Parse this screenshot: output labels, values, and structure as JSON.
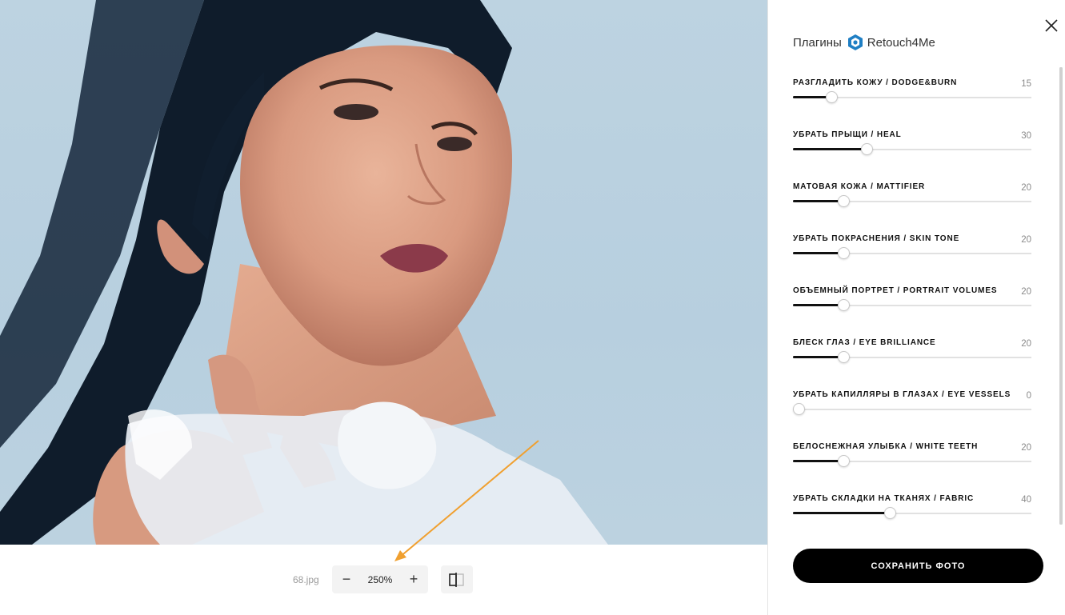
{
  "viewer": {
    "filename": "68.jpg",
    "zoom": "250%",
    "zoom_out_label": "−",
    "zoom_in_label": "+"
  },
  "panel": {
    "title": "Плагины",
    "brand": "Retouch4Me",
    "save_label": "СОХРАНИТЬ ФОТО"
  },
  "plugins": [
    {
      "label": "РАЗГЛАДИТЬ КОЖУ / DODGE&BURN",
      "value": "15",
      "fraction": 0.16
    },
    {
      "label": "УБРАТЬ ПРЫЩИ / HEAL",
      "value": "30",
      "fraction": 0.31
    },
    {
      "label": "МАТОВАЯ КОЖА / MATTIFIER",
      "value": "20",
      "fraction": 0.21
    },
    {
      "label": "УБРАТЬ ПОКРАСНЕНИЯ / SKIN TONE",
      "value": "20",
      "fraction": 0.21
    },
    {
      "label": "ОБЪЕМНЫЙ ПОРТРЕТ / PORTRAIT VOLUMES",
      "value": "20",
      "fraction": 0.21
    },
    {
      "label": "БЛЕСК ГЛАЗ / EYE BRILLIANCE",
      "value": "20",
      "fraction": 0.21
    },
    {
      "label": "УБРАТЬ КАПИЛЛЯРЫ В ГЛАЗАХ / EYE VESSELS",
      "value": "0",
      "fraction": 0.0
    },
    {
      "label": "БЕЛОСНЕЖНАЯ УЛЫБКА / WHITE TEETH",
      "value": "20",
      "fraction": 0.21
    },
    {
      "label": "УБРАТЬ СКЛАДКИ НА ТКАНЯХ / FABRIC",
      "value": "40",
      "fraction": 0.405
    }
  ],
  "colors": {
    "accent": "#000000",
    "annotation_arrow": "#f0a030",
    "brand_logo": "#1f7fc4"
  },
  "icons": {
    "close": "close-icon",
    "compare": "compare-split-icon",
    "brand": "retouch4me-logo-icon"
  }
}
